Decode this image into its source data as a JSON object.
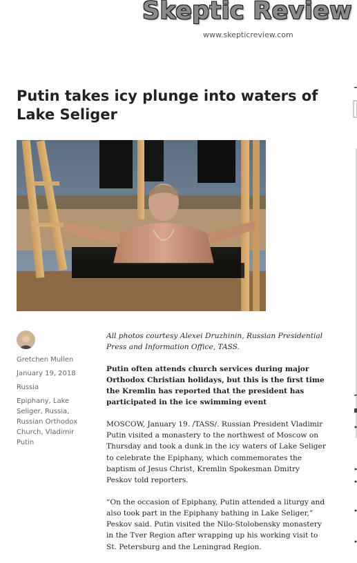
{
  "site": {
    "title": "Skeptic Review",
    "url": "www.skepticreview.com"
  },
  "article": {
    "headline": "Putin takes icy plunge into waters of Lake Seliger",
    "image_alt": "Putin in icy water",
    "caption": "All photos courtesy Alexei Druzhinin, Russian Presidential Press and Information Office, TASS.",
    "lede": "Putin often attends church services during major Orthodox Christian holidays, but this is the first time the Kremlin has reported that the president has participated in the ice swimming event",
    "paragraphs": [
      "MOSCOW, January 19. /TASS/. Russian President Vladimir Putin visited a monastery to the northwest of Moscow on Thursday and took a dunk in the icy waters of Lake Seliger to celebrate the Epiphany, which commemorates the baptism of Jesus Christ, Kremlin Spokesman Dmitry Peskov told reporters.",
      "“On the occasion of Epiphany, Putin attended a liturgy and also took part in the Epiphany bathing in Lake Seliger,” Peskov said. Putin visited the Nilo-Stolobensky monastery in the Tver Region after wrapping up his working visit to St. Petersburg and the Leningrad Region."
    ]
  },
  "meta": {
    "author": "Gretchen Mullen",
    "date": "January 19, 2018",
    "category": "Russia",
    "tags": "Epiphany, Lake Seliger, Russia, Russian Orthodox Church, Vladimir Putin"
  },
  "colors": {
    "title_fill": "#8a8a8a",
    "text": "#222222",
    "meta_text": "#666666"
  }
}
